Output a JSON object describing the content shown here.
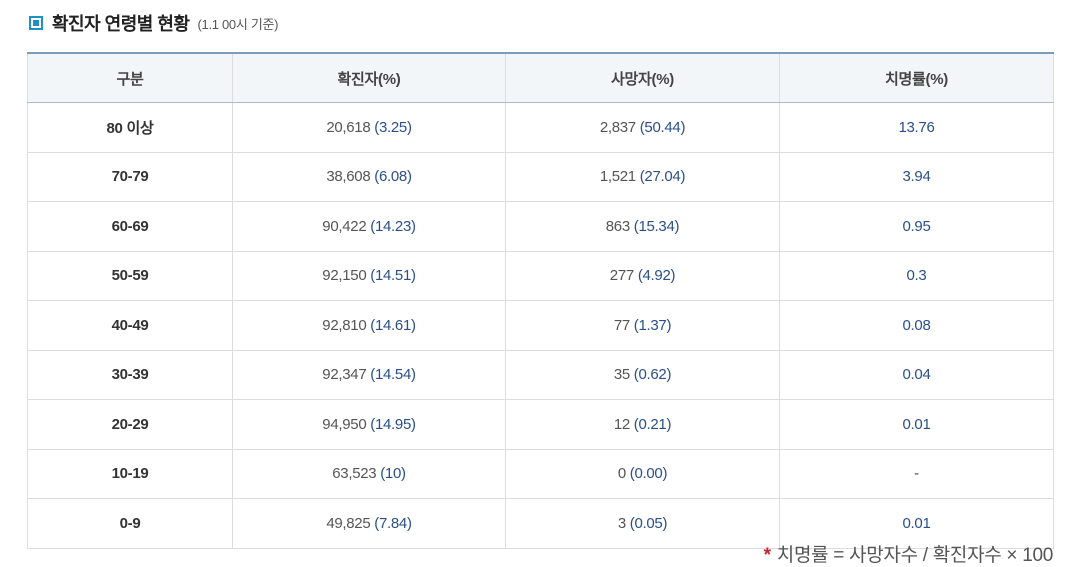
{
  "title": {
    "text": "확진자 연령별 현황",
    "sub": "(1.1 00시 기준)"
  },
  "table": {
    "headers": [
      "구분",
      "확진자(%)",
      "사망자(%)",
      "치명률(%)"
    ],
    "rows": [
      {
        "age": "80 이상",
        "cases": "20,618",
        "cases_pct": "(3.25)",
        "deaths": "2,837",
        "deaths_pct": "(50.44)",
        "fatality": "13.76"
      },
      {
        "age": "70-79",
        "cases": "38,608",
        "cases_pct": "(6.08)",
        "deaths": "1,521",
        "deaths_pct": "(27.04)",
        "fatality": "3.94"
      },
      {
        "age": "60-69",
        "cases": "90,422",
        "cases_pct": "(14.23)",
        "deaths": "863",
        "deaths_pct": "(15.34)",
        "fatality": "0.95"
      },
      {
        "age": "50-59",
        "cases": "92,150",
        "cases_pct": "(14.51)",
        "deaths": "277",
        "deaths_pct": "(4.92)",
        "fatality": "0.3"
      },
      {
        "age": "40-49",
        "cases": "92,810",
        "cases_pct": "(14.61)",
        "deaths": "77",
        "deaths_pct": "(1.37)",
        "fatality": "0.08"
      },
      {
        "age": "30-39",
        "cases": "92,347",
        "cases_pct": "(14.54)",
        "deaths": "35",
        "deaths_pct": "(0.62)",
        "fatality": "0.04"
      },
      {
        "age": "20-29",
        "cases": "94,950",
        "cases_pct": "(14.95)",
        "deaths": "12",
        "deaths_pct": "(0.21)",
        "fatality": "0.01"
      },
      {
        "age": "10-19",
        "cases": "63,523",
        "cases_pct": "(10)",
        "deaths": "0",
        "deaths_pct": "(0.00)",
        "fatality": "-"
      },
      {
        "age": "0-9",
        "cases": "49,825",
        "cases_pct": "(7.84)",
        "deaths": "3",
        "deaths_pct": "(0.05)",
        "fatality": "0.01"
      }
    ]
  },
  "footnote": {
    "star": "*",
    "text": "치명률 = 사망자수 / 확진자수 × 100"
  },
  "colors": {
    "accent": "#1e90c8",
    "header_border": "#7a9cb6",
    "paren_text": "#2a4f8a",
    "footnote_star": "#c0272d"
  },
  "icons": {
    "title": "square-bullet-icon"
  }
}
